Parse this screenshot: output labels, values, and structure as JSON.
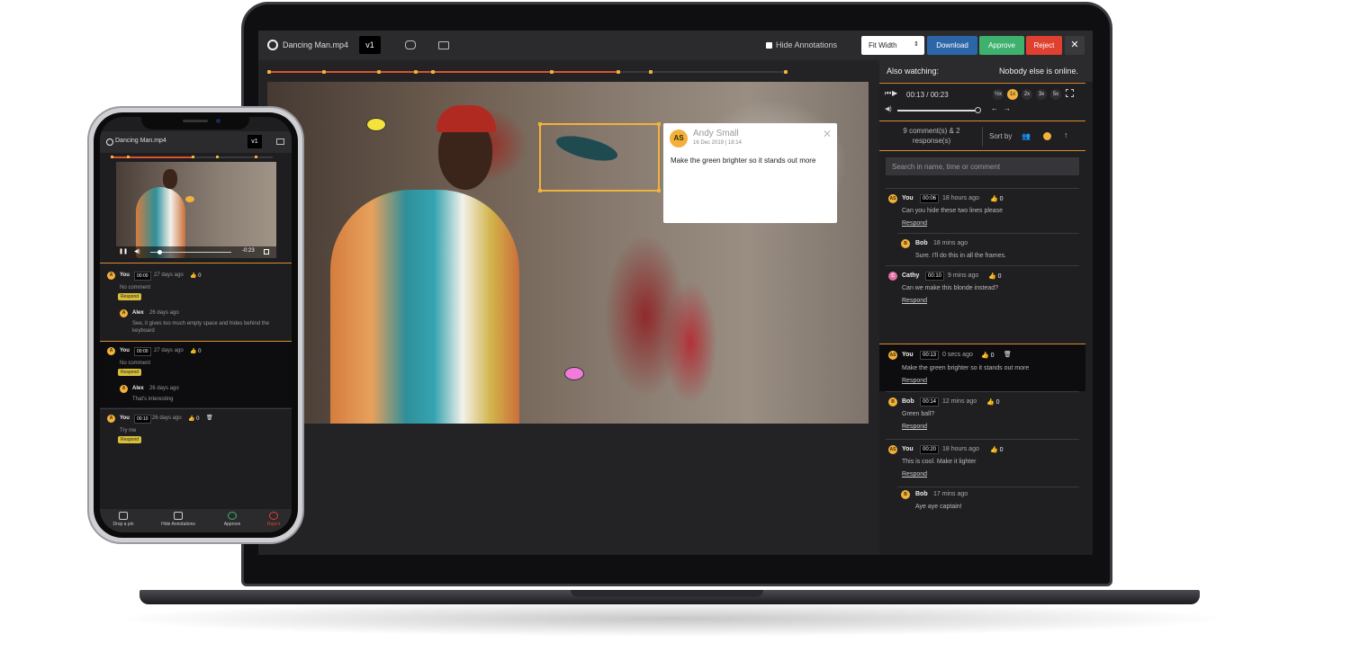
{
  "laptop": {
    "file_name": "Dancing Man.mp4",
    "version": "v1",
    "hide_annotations_label": "Hide Annotations",
    "fit_select": "Fit Width",
    "download_label": "Download",
    "approve_label": "Approve",
    "reject_label": "Reject",
    "close_label": "✕",
    "popup": {
      "avatar": "AS",
      "name": "Andy Small",
      "date": "16 Dec 2019 | 18:14",
      "close": "✕",
      "text": "Make the green brighter so it stands out more"
    },
    "sidebar": {
      "also_watching": "Also watching:",
      "status": "Nobody else is online.",
      "time": "00:13 / 00:23",
      "speeds": [
        "½x",
        "1x",
        "2x",
        "3x",
        "5x"
      ],
      "active_speed": "1x",
      "comment_count": "9 comment(s) & 2 response(s)",
      "sort_by": "Sort by",
      "search_placeholder": "Search in name, time or comment",
      "comments": [
        {
          "avatar": "AS",
          "name": "You",
          "ts": "00:06",
          "ago": "18 hours ago",
          "likes": "0",
          "text": "Can you hide these two lines please",
          "respond": "Respond"
        },
        {
          "avatar": "B",
          "name": "Bob",
          "ago": "18 mins ago",
          "text": "Sure. I'll do this in all the frames."
        },
        {
          "avatar": "C",
          "name": "Cathy",
          "ts": "00:10",
          "ago": "9 mins ago",
          "likes": "0",
          "text": "Can we make this blonde instead?",
          "respond": "Respond"
        },
        {
          "avatar": "AS",
          "name": "You",
          "ts": "00:13",
          "ago": "0 secs ago",
          "likes": "0",
          "text": "Make the green brighter so it stands out more",
          "respond": "Respond"
        },
        {
          "avatar": "B",
          "name": "Bob",
          "ts": "00:14",
          "ago": "12 mins ago",
          "likes": "0",
          "text": "Green ball?",
          "respond": "Respond"
        },
        {
          "avatar": "AS",
          "name": "You",
          "ts": "00:20",
          "ago": "18 hours ago",
          "likes": "0",
          "text": "This is cool. Make it lighter",
          "respond": "Respond"
        },
        {
          "avatar": "B",
          "name": "Bob",
          "ago": "17 mins ago",
          "text": "Aye aye captain!"
        }
      ]
    }
  },
  "phone": {
    "file_name": "Dancing Man.mp4",
    "version": "v1",
    "time_remaining": "-0:23",
    "comments": [
      {
        "avatar": "A",
        "name": "You",
        "ts": "00:00",
        "ago": "27 days ago",
        "likes": "0",
        "text": "No comment",
        "respond": "Respond"
      },
      {
        "avatar": "A",
        "name": "Alex",
        "ago": "26 days ago",
        "text": "See, it gives too much empty space and hides behind the keyboard"
      },
      {
        "avatar": "A",
        "name": "You",
        "ts": "00:00",
        "ago": "27 days ago",
        "likes": "0",
        "text": "No comment",
        "respond": "Respond"
      },
      {
        "avatar": "A",
        "name": "Alex",
        "ago": "26 days ago",
        "text": "That's interesting"
      },
      {
        "avatar": "A",
        "name": "You",
        "ts": "00:10",
        "ago": "26 days ago",
        "likes": "0",
        "text": "Try me",
        "respond": "Respond"
      }
    ],
    "bottom": {
      "drop_pin": "Drop a pin",
      "hide_annotations": "Hide Annotations",
      "approve": "Approve",
      "reject": "Reject"
    }
  },
  "colors": {
    "accent": "#f2b13b",
    "download": "#2d66a8",
    "approve": "#3db16d",
    "reject": "#e0402f"
  }
}
